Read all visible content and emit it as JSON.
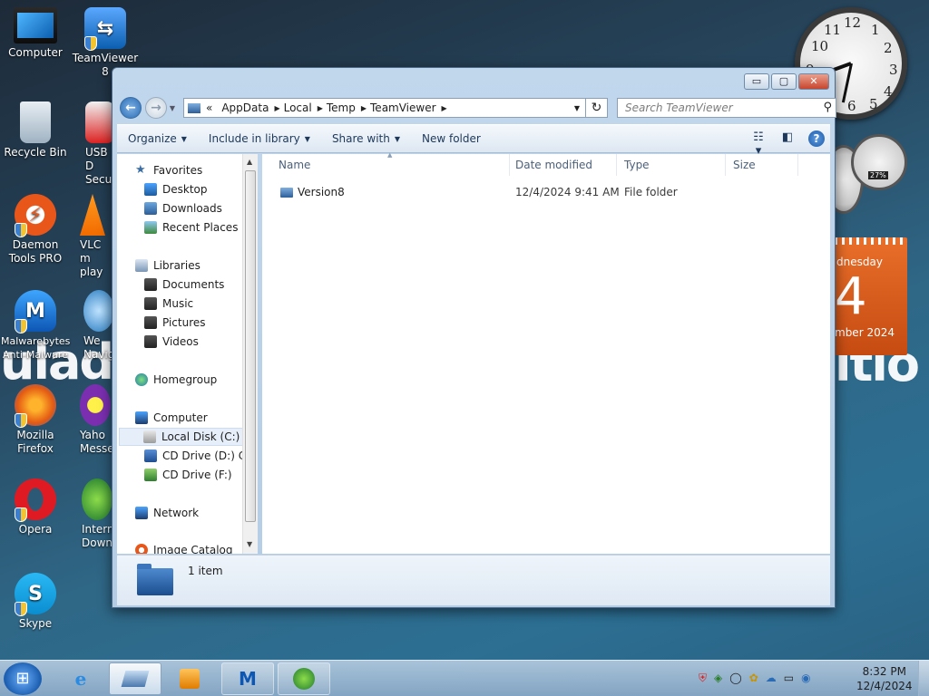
{
  "desktop": {
    "icons": [
      {
        "label": "Computer"
      },
      {
        "label": "TeamViewer 8"
      },
      {
        "label": "Recycle Bin"
      },
      {
        "label": "USB D\nSecu"
      },
      {
        "label": "Daemon Tools PRO"
      },
      {
        "label": "VLC m\nplay"
      },
      {
        "label": "Malwarebytes Anti-Malware"
      },
      {
        "label": "We\nNaviga"
      },
      {
        "label": "Mozilla Firefox"
      },
      {
        "label": "Yaho\nMesse"
      },
      {
        "label": "Opera"
      },
      {
        "label": "Intern\nDown"
      },
      {
        "label": "Skype"
      }
    ],
    "calendar": {
      "day": "dnesday",
      "date": "4",
      "month": "mber 2024"
    },
    "clock_numbers": [
      "12",
      "1",
      "2",
      "3",
      "4",
      "5",
      "6",
      "10",
      "11",
      "9"
    ],
    "gauge_value": "27%"
  },
  "window": {
    "controls": {
      "minimize": "▭",
      "maximize": "▢",
      "close": "✕"
    },
    "address": {
      "segments": [
        "AppData",
        "Local",
        "Temp",
        "TeamViewer"
      ],
      "overflow": "«"
    },
    "search": {
      "placeholder": "Search TeamViewer"
    },
    "toolbar": {
      "organize": "Organize",
      "include_in_library": "Include in library",
      "share_with": "Share with",
      "new_folder": "New folder"
    },
    "nav": {
      "favorites": "Favorites",
      "desktop": "Desktop",
      "downloads": "Downloads",
      "recent_places": "Recent Places",
      "libraries": "Libraries",
      "documents": "Documents",
      "music": "Music",
      "pictures": "Pictures",
      "videos": "Videos",
      "homegroup": "Homegroup",
      "computer": "Computer",
      "local_disk": "Local Disk (C:)",
      "cd_drive_d": "CD Drive (D:) CD",
      "cd_drive_f": "CD Drive (F:)",
      "network": "Network",
      "image_catalog": "Image Catalog"
    },
    "columns": {
      "name": "Name",
      "date_modified": "Date modified",
      "type": "Type",
      "size": "Size"
    },
    "files": [
      {
        "name": "Version8",
        "date_modified": "12/4/2024 9:41 AM",
        "type": "File folder",
        "size": ""
      }
    ],
    "details": {
      "item_count": "1 item"
    }
  },
  "taskbar": {
    "time": "8:32 PM",
    "date": "12/4/2024"
  },
  "colors": {
    "accent": "#2a6bb5",
    "window_frame": "#b4cde5",
    "calendar": "#e96f2a"
  }
}
